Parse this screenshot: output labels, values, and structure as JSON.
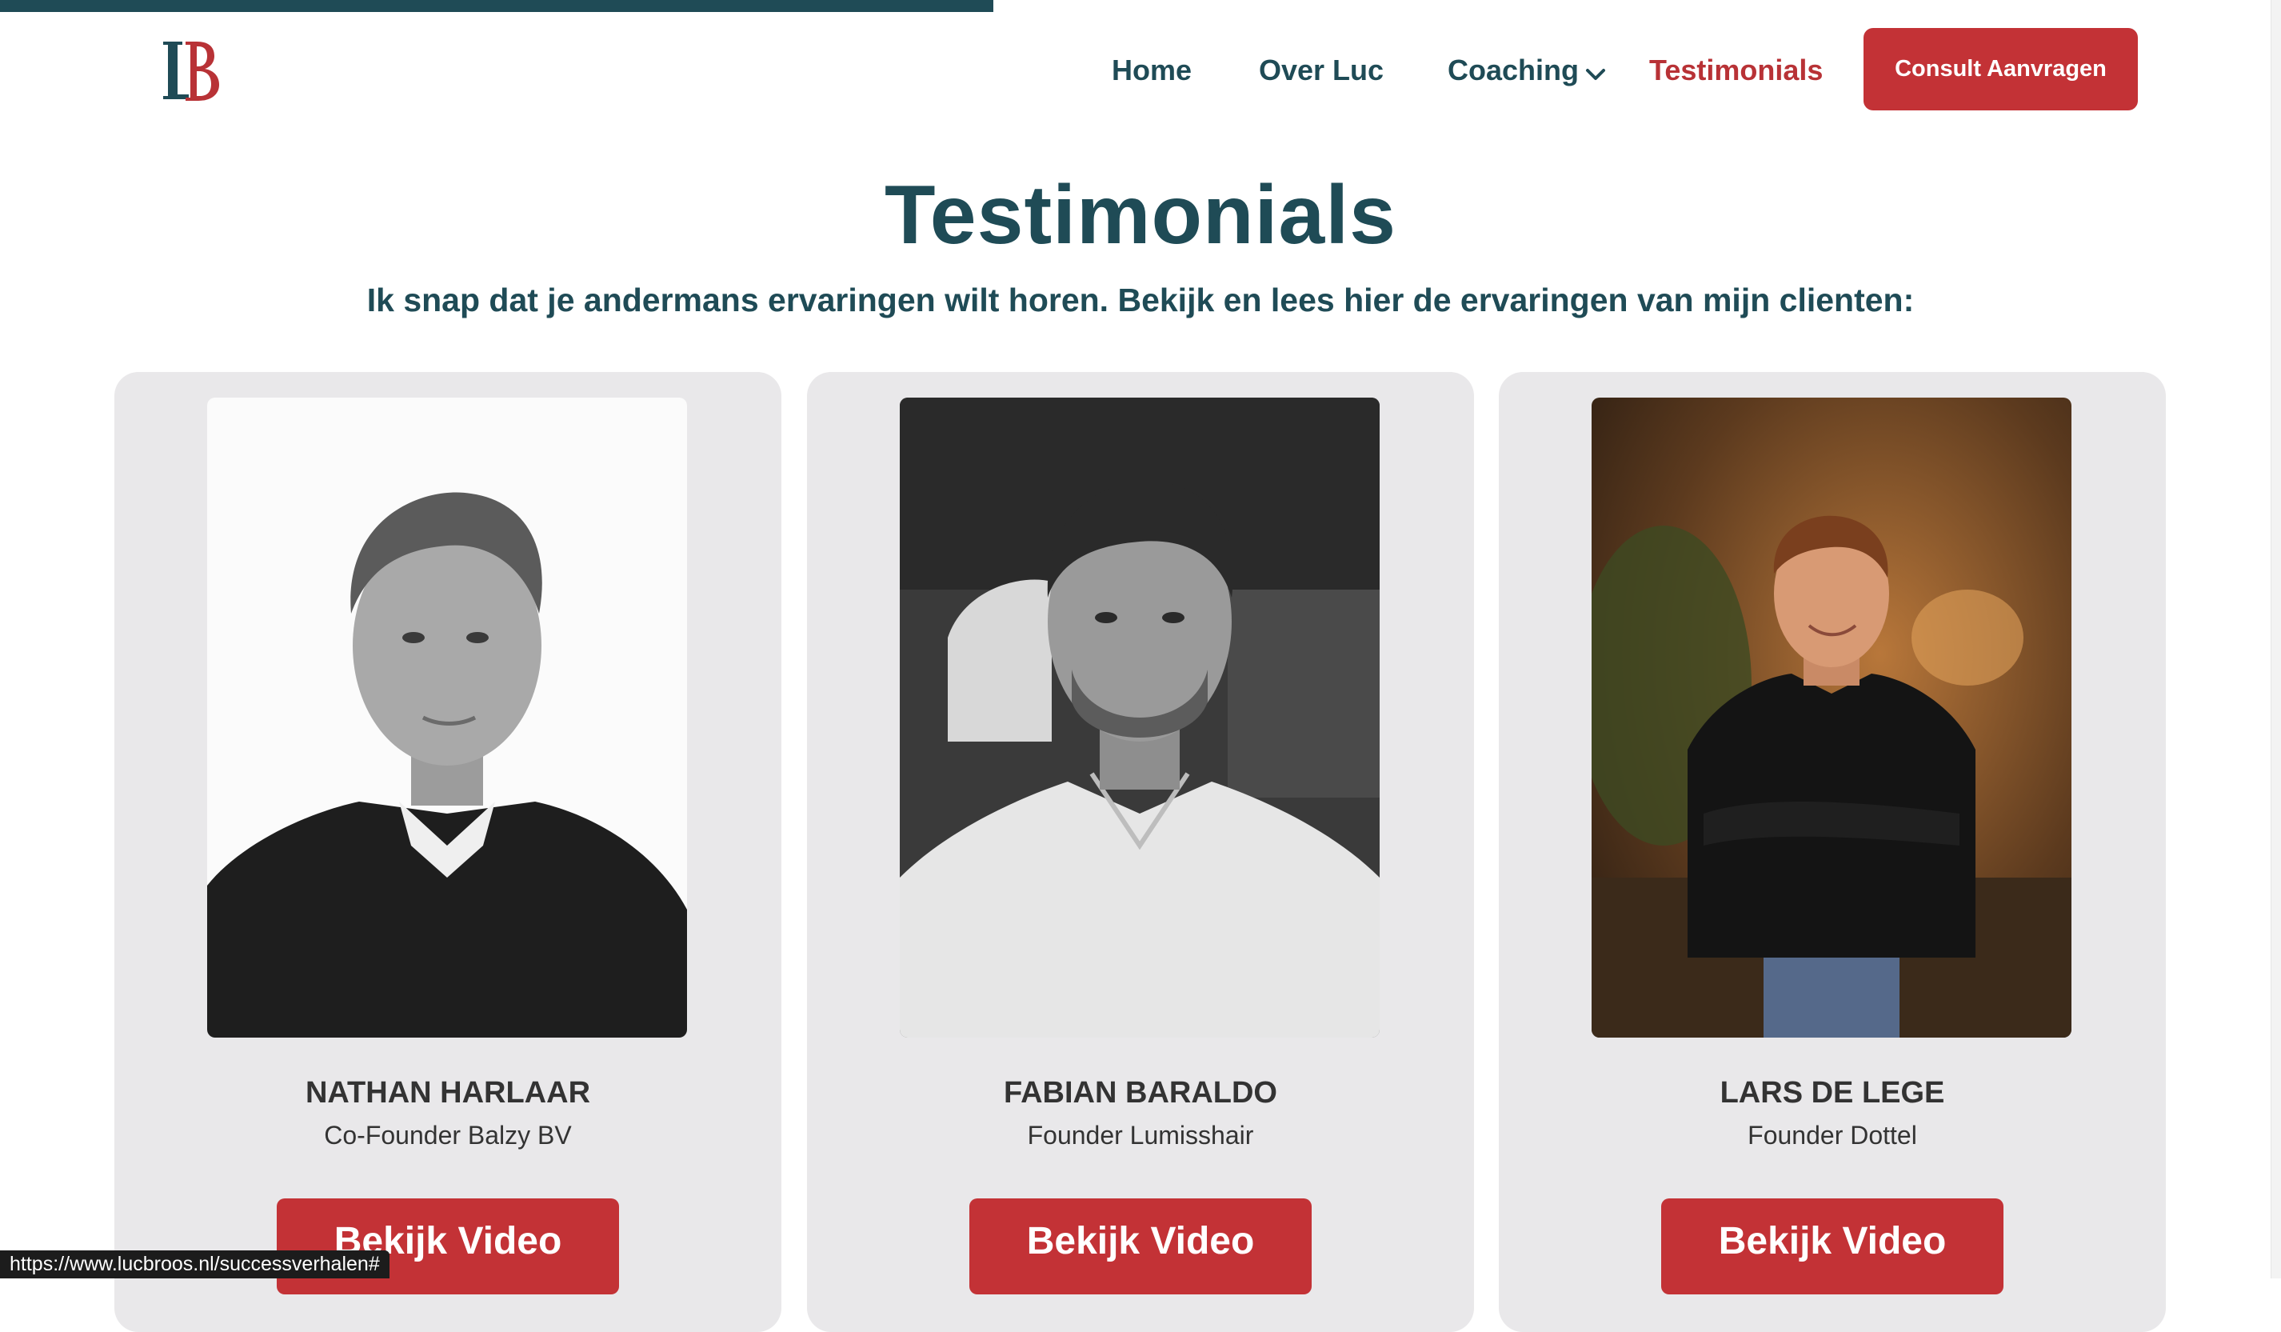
{
  "header": {
    "logo_alt": "LB",
    "nav": [
      {
        "label": "Home"
      },
      {
        "label": "Over Luc"
      },
      {
        "label": "Coaching"
      },
      {
        "label": "Testimonials"
      }
    ],
    "cta_label": "Consult Aanvragen"
  },
  "main": {
    "title": "Testimonials",
    "subtitle": "Ik snap dat je andermans ervaringen wilt horen. Bekijk en lees hier de ervaringen van mijn clienten:",
    "testimonials": [
      {
        "name": "NATHAN HARLAAR",
        "role": "Co-Founder Balzy BV",
        "button_label": "Bekijk Video"
      },
      {
        "name": "FABIAN BARALDO",
        "role": "Founder Lumisshair",
        "button_label": "Bekijk Video"
      },
      {
        "name": "LARS DE LEGE",
        "role": "Founder Dottel",
        "button_label": "Bekijk Video"
      }
    ]
  },
  "status_bar": {
    "url": "https://www.lucbroos.nl/successverhalen#"
  },
  "colors": {
    "brand_teal": "#1f4b56",
    "brand_red": "#c33236",
    "card_bg": "#e9e8ea"
  },
  "icons": {
    "coaching_dropdown": "chevron-down-icon"
  }
}
